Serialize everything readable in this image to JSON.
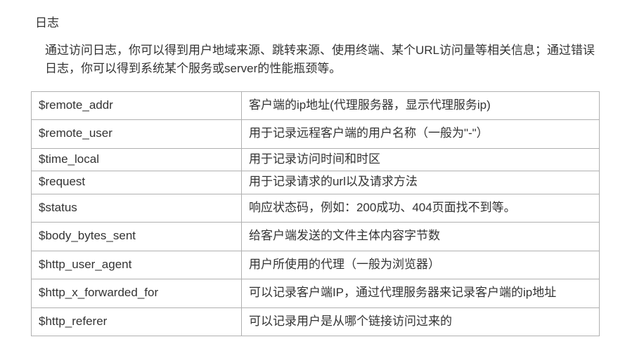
{
  "title": "日志",
  "description": "通过访问日志，你可以得到用户地域来源、跳转来源、使用终端、某个URL访问量等相关信息；通过错误日志，你可以得到系统某个服务或server的性能瓶颈等。",
  "rows": [
    {
      "var": "$remote_addr",
      "desc": "客户端的ip地址(代理服务器，显示代理服务ip)"
    },
    {
      "var": "$remote_user",
      "desc": "用于记录远程客户端的用户名称（一般为\"-\"）"
    },
    {
      "var": "$time_local",
      "desc": "用于记录访问时间和时区"
    },
    {
      "var": "$request",
      "desc": "用于记录请求的url以及请求方法"
    },
    {
      "var": "$status",
      "desc": "响应状态码，例如：200成功、404页面找不到等。"
    },
    {
      "var": "$body_bytes_sent",
      "desc": "给客户端发送的文件主体内容字节数"
    },
    {
      "var": "$http_user_agent",
      "desc": "用户所使用的代理（一般为浏览器）"
    },
    {
      "var": "$http_x_forwarded_for",
      "desc": "可以记录客户端IP，通过代理服务器来记录客户端的ip地址"
    },
    {
      "var": "$http_referer",
      "desc": "可以记录用户是从哪个链接访问过来的"
    }
  ]
}
